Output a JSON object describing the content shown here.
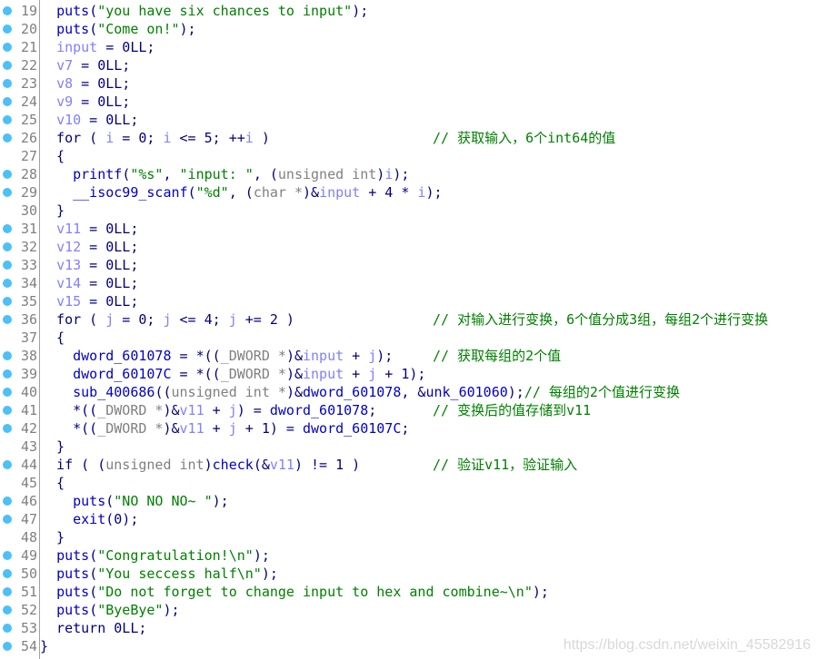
{
  "colors": {
    "keyword": "#0000c8",
    "string": "#008000",
    "variable": "#8080ff",
    "cast": "#808080",
    "comment": "#008000",
    "breakpoint_dot": "#4cc0f8"
  },
  "watermark": "https://blog.csdn.net/weixin_45582916",
  "lines": [
    {
      "n": "19",
      "dot": true,
      "t": [
        [
          "  ",
          "p"
        ],
        [
          "puts",
          "k"
        ],
        [
          "(",
          "p"
        ],
        [
          "\"you have six chances to input\"",
          "s"
        ],
        [
          ");",
          "p"
        ]
      ]
    },
    {
      "n": "20",
      "dot": true,
      "t": [
        [
          "  ",
          "p"
        ],
        [
          "puts",
          "k"
        ],
        [
          "(",
          "p"
        ],
        [
          "\"Come on!\"",
          "s"
        ],
        [
          ");",
          "p"
        ]
      ]
    },
    {
      "n": "21",
      "dot": true,
      "t": [
        [
          "  ",
          "p"
        ],
        [
          "input",
          "v"
        ],
        [
          " = 0LL;",
          "p"
        ]
      ]
    },
    {
      "n": "22",
      "dot": true,
      "t": [
        [
          "  ",
          "p"
        ],
        [
          "v7",
          "v"
        ],
        [
          " = 0LL;",
          "p"
        ]
      ]
    },
    {
      "n": "23",
      "dot": true,
      "t": [
        [
          "  ",
          "p"
        ],
        [
          "v8",
          "v"
        ],
        [
          " = 0LL;",
          "p"
        ]
      ]
    },
    {
      "n": "24",
      "dot": true,
      "t": [
        [
          "  ",
          "p"
        ],
        [
          "v9",
          "v"
        ],
        [
          " = 0LL;",
          "p"
        ]
      ]
    },
    {
      "n": "25",
      "dot": true,
      "t": [
        [
          "  ",
          "p"
        ],
        [
          "v10",
          "v"
        ],
        [
          " = 0LL;",
          "p"
        ]
      ]
    },
    {
      "n": "26",
      "dot": true,
      "t": [
        [
          "  for ( ",
          "p"
        ],
        [
          "i",
          "v"
        ],
        [
          " = 0; ",
          "p"
        ],
        [
          "i",
          "v"
        ],
        [
          " <= 5; ++",
          "p"
        ],
        [
          "i",
          "v"
        ],
        [
          " )",
          "p"
        ]
      ],
      "c": "// 获取输入，6个int64的值"
    },
    {
      "n": "27",
      "dot": false,
      "t": [
        [
          "  {",
          "p"
        ]
      ]
    },
    {
      "n": "28",
      "dot": true,
      "t": [
        [
          "    ",
          "p"
        ],
        [
          "printf",
          "k"
        ],
        [
          "(",
          "p"
        ],
        [
          "\"%s\"",
          "s"
        ],
        [
          ", ",
          "p"
        ],
        [
          "\"input: \"",
          "s"
        ],
        [
          ", (",
          "p"
        ],
        [
          "unsigned int",
          "c"
        ],
        [
          ")",
          "p"
        ],
        [
          "i",
          "v"
        ],
        [
          ");",
          "p"
        ]
      ]
    },
    {
      "n": "29",
      "dot": true,
      "t": [
        [
          "    ",
          "p"
        ],
        [
          "__isoc99_scanf",
          "k"
        ],
        [
          "(",
          "p"
        ],
        [
          "\"%d\"",
          "s"
        ],
        [
          ", (",
          "p"
        ],
        [
          "char *",
          "c"
        ],
        [
          ")&",
          "p"
        ],
        [
          "input",
          "v"
        ],
        [
          " + 4 * ",
          "p"
        ],
        [
          "i",
          "v"
        ],
        [
          ");",
          "p"
        ]
      ]
    },
    {
      "n": "30",
      "dot": false,
      "t": [
        [
          "  }",
          "p"
        ]
      ]
    },
    {
      "n": "31",
      "dot": true,
      "t": [
        [
          "  ",
          "p"
        ],
        [
          "v11",
          "v"
        ],
        [
          " = 0LL;",
          "p"
        ]
      ]
    },
    {
      "n": "32",
      "dot": true,
      "t": [
        [
          "  ",
          "p"
        ],
        [
          "v12",
          "v"
        ],
        [
          " = 0LL;",
          "p"
        ]
      ]
    },
    {
      "n": "33",
      "dot": true,
      "t": [
        [
          "  ",
          "p"
        ],
        [
          "v13",
          "v"
        ],
        [
          " = 0LL;",
          "p"
        ]
      ]
    },
    {
      "n": "34",
      "dot": true,
      "t": [
        [
          "  ",
          "p"
        ],
        [
          "v14",
          "v"
        ],
        [
          " = 0LL;",
          "p"
        ]
      ]
    },
    {
      "n": "35",
      "dot": true,
      "t": [
        [
          "  ",
          "p"
        ],
        [
          "v15",
          "v"
        ],
        [
          " = 0LL;",
          "p"
        ]
      ]
    },
    {
      "n": "36",
      "dot": true,
      "t": [
        [
          "  for ( ",
          "p"
        ],
        [
          "j",
          "v"
        ],
        [
          " = 0; ",
          "p"
        ],
        [
          "j",
          "v"
        ],
        [
          " <= 4; ",
          "p"
        ],
        [
          "j",
          "v"
        ],
        [
          " += 2 )",
          "p"
        ]
      ],
      "c": "// 对输入进行变换，6个值分成3组，每组2个进行变换"
    },
    {
      "n": "37",
      "dot": false,
      "t": [
        [
          "  {",
          "p"
        ]
      ]
    },
    {
      "n": "38",
      "dot": true,
      "t": [
        [
          "    ",
          "p"
        ],
        [
          "dword_601078",
          "k"
        ],
        [
          " = *((",
          "p"
        ],
        [
          "_DWORD *",
          "c"
        ],
        [
          ")&",
          "p"
        ],
        [
          "input",
          "v"
        ],
        [
          " + ",
          "p"
        ],
        [
          "j",
          "v"
        ],
        [
          ");",
          "p"
        ]
      ],
      "c": "// 获取每组的2个值"
    },
    {
      "n": "39",
      "dot": true,
      "t": [
        [
          "    ",
          "p"
        ],
        [
          "dword_60107C",
          "k"
        ],
        [
          " = *((",
          "p"
        ],
        [
          "_DWORD *",
          "c"
        ],
        [
          ")&",
          "p"
        ],
        [
          "input",
          "v"
        ],
        [
          " + ",
          "p"
        ],
        [
          "j",
          "v"
        ],
        [
          " + 1);",
          "p"
        ]
      ]
    },
    {
      "n": "40",
      "dot": true,
      "t": [
        [
          "    ",
          "p"
        ],
        [
          "sub_400686",
          "k"
        ],
        [
          "((",
          "p"
        ],
        [
          "unsigned int *",
          "c"
        ],
        [
          ")&",
          "p"
        ],
        [
          "dword_601078",
          "k"
        ],
        [
          ", &",
          "p"
        ],
        [
          "unk_601060",
          "k"
        ],
        [
          ");",
          "p"
        ],
        [
          "// 每组的2个值进行变换",
          "m"
        ]
      ]
    },
    {
      "n": "41",
      "dot": true,
      "t": [
        [
          "    *((",
          "p"
        ],
        [
          "_DWORD *",
          "c"
        ],
        [
          ")&",
          "p"
        ],
        [
          "v11",
          "v"
        ],
        [
          " + ",
          "p"
        ],
        [
          "j",
          "v"
        ],
        [
          ") = ",
          "p"
        ],
        [
          "dword_601078",
          "k"
        ],
        [
          ";",
          "p"
        ]
      ],
      "c": "// 变换后的值存储到v11"
    },
    {
      "n": "42",
      "dot": true,
      "t": [
        [
          "    *((",
          "p"
        ],
        [
          "_DWORD *",
          "c"
        ],
        [
          ")&",
          "p"
        ],
        [
          "v11",
          "v"
        ],
        [
          " + ",
          "p"
        ],
        [
          "j",
          "v"
        ],
        [
          " + 1) = ",
          "p"
        ],
        [
          "dword_60107C",
          "k"
        ],
        [
          ";",
          "p"
        ]
      ]
    },
    {
      "n": "43",
      "dot": false,
      "t": [
        [
          "  }",
          "p"
        ]
      ]
    },
    {
      "n": "44",
      "dot": true,
      "t": [
        [
          "  if ( (",
          "p"
        ],
        [
          "unsigned int",
          "c"
        ],
        [
          ")",
          "p"
        ],
        [
          "check",
          "k"
        ],
        [
          "(&",
          "p"
        ],
        [
          "v11",
          "v"
        ],
        [
          ") != 1 )",
          "p"
        ]
      ],
      "c": "// 验证v11，验证输入"
    },
    {
      "n": "45",
      "dot": false,
      "t": [
        [
          "  {",
          "p"
        ]
      ]
    },
    {
      "n": "46",
      "dot": true,
      "t": [
        [
          "    ",
          "p"
        ],
        [
          "puts",
          "k"
        ],
        [
          "(",
          "p"
        ],
        [
          "\"NO NO NO~ \"",
          "s"
        ],
        [
          ");",
          "p"
        ]
      ]
    },
    {
      "n": "47",
      "dot": true,
      "t": [
        [
          "    ",
          "p"
        ],
        [
          "exit",
          "k"
        ],
        [
          "(0);",
          "p"
        ]
      ]
    },
    {
      "n": "48",
      "dot": false,
      "t": [
        [
          "  }",
          "p"
        ]
      ]
    },
    {
      "n": "49",
      "dot": true,
      "t": [
        [
          "  ",
          "p"
        ],
        [
          "puts",
          "k"
        ],
        [
          "(",
          "p"
        ],
        [
          "\"Congratulation!\\n\"",
          "s"
        ],
        [
          ");",
          "p"
        ]
      ]
    },
    {
      "n": "50",
      "dot": true,
      "t": [
        [
          "  ",
          "p"
        ],
        [
          "puts",
          "k"
        ],
        [
          "(",
          "p"
        ],
        [
          "\"You seccess half\\n\"",
          "s"
        ],
        [
          ");",
          "p"
        ]
      ]
    },
    {
      "n": "51",
      "dot": true,
      "t": [
        [
          "  ",
          "p"
        ],
        [
          "puts",
          "k"
        ],
        [
          "(",
          "p"
        ],
        [
          "\"Do not forget to change input to hex and combine~\\n\"",
          "s"
        ],
        [
          ");",
          "p"
        ]
      ]
    },
    {
      "n": "52",
      "dot": true,
      "t": [
        [
          "  ",
          "p"
        ],
        [
          "puts",
          "k"
        ],
        [
          "(",
          "p"
        ],
        [
          "\"ByeBye\"",
          "s"
        ],
        [
          ");",
          "p"
        ]
      ]
    },
    {
      "n": "53",
      "dot": true,
      "t": [
        [
          "  return 0LL;",
          "p"
        ]
      ]
    },
    {
      "n": "54",
      "dot": true,
      "t": [
        [
          "}",
          "p"
        ]
      ]
    }
  ]
}
